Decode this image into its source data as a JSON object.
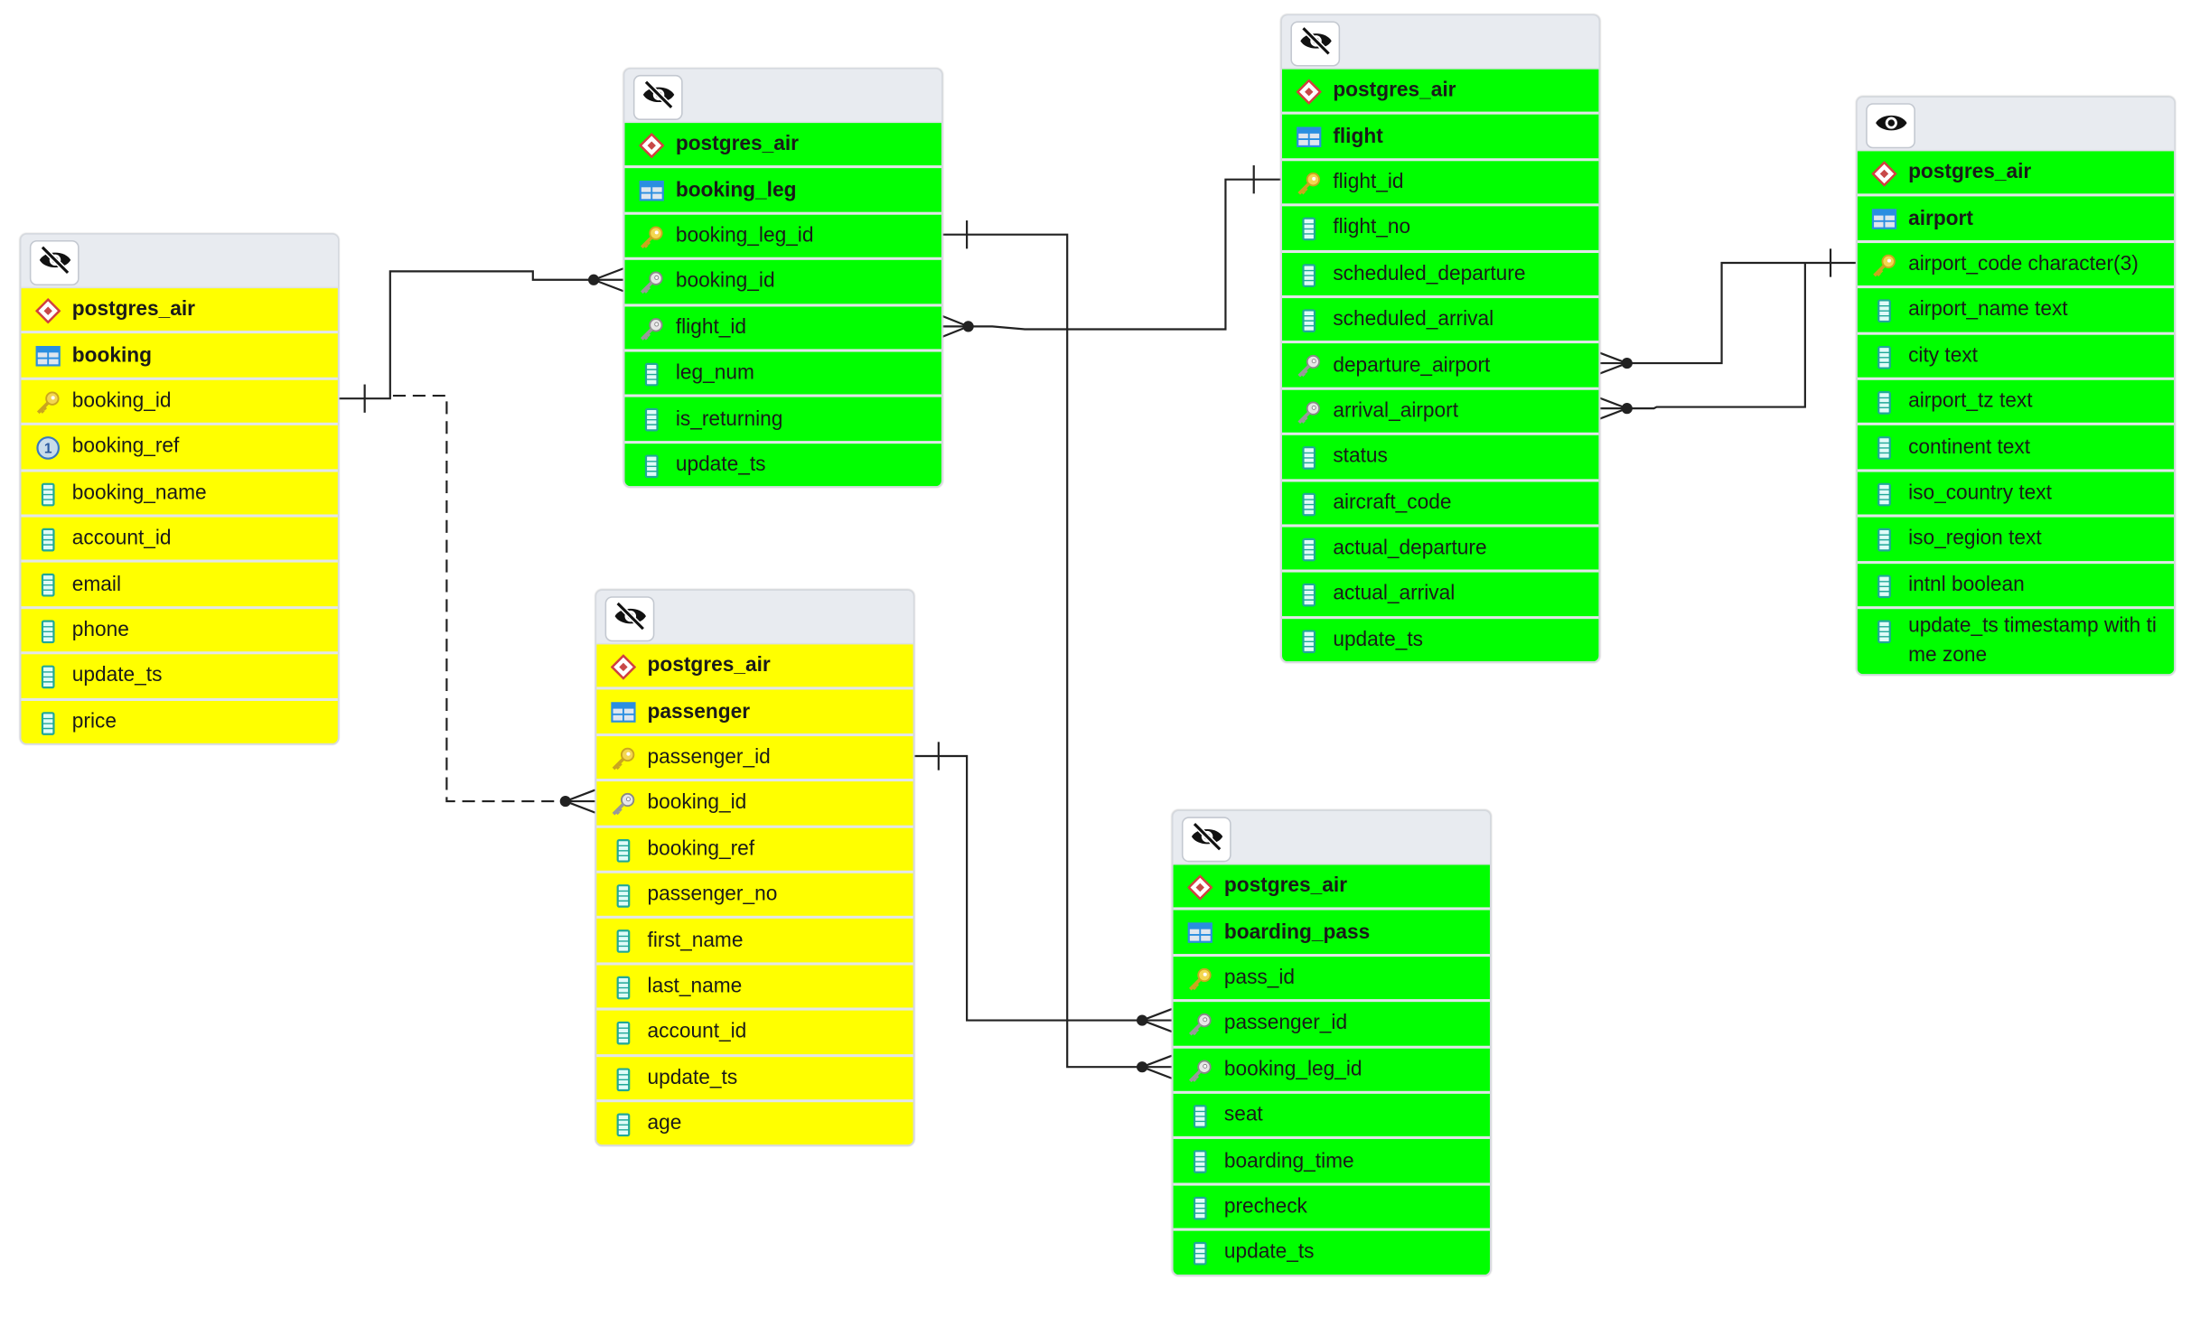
{
  "colors": {
    "yellow_table": "#ffff00",
    "green_table": "#00ff00",
    "header": "#e8ebf0",
    "line": "#222222"
  },
  "tables": [
    {
      "id": "booking",
      "color": "yellow",
      "visibility_icon": "eye-slash-icon",
      "schema": "postgres_air",
      "name": "booking",
      "columns": [
        {
          "label": "booking_id",
          "icon": "pk"
        },
        {
          "label": "booking_ref",
          "icon": "unique"
        },
        {
          "label": "booking_name",
          "icon": "column"
        },
        {
          "label": "account_id",
          "icon": "column"
        },
        {
          "label": "email",
          "icon": "column"
        },
        {
          "label": "phone",
          "icon": "column"
        },
        {
          "label": "update_ts",
          "icon": "column"
        },
        {
          "label": "price",
          "icon": "column"
        }
      ]
    },
    {
      "id": "booking_leg",
      "color": "green",
      "visibility_icon": "eye-slash-icon",
      "schema": "postgres_air",
      "name": "booking_leg",
      "columns": [
        {
          "label": "booking_leg_id",
          "icon": "pk"
        },
        {
          "label": "booking_id",
          "icon": "fk"
        },
        {
          "label": "flight_id",
          "icon": "fk"
        },
        {
          "label": "leg_num",
          "icon": "column"
        },
        {
          "label": "is_returning",
          "icon": "column"
        },
        {
          "label": "update_ts",
          "icon": "column"
        }
      ]
    },
    {
      "id": "flight",
      "color": "green",
      "visibility_icon": "eye-slash-icon",
      "schema": "postgres_air",
      "name": "flight",
      "columns": [
        {
          "label": "flight_id",
          "icon": "pk"
        },
        {
          "label": "flight_no",
          "icon": "column"
        },
        {
          "label": "scheduled_departure",
          "icon": "column"
        },
        {
          "label": "scheduled_arrival",
          "icon": "column"
        },
        {
          "label": "departure_airport",
          "icon": "fk"
        },
        {
          "label": "arrival_airport",
          "icon": "fk"
        },
        {
          "label": "status",
          "icon": "column"
        },
        {
          "label": "aircraft_code",
          "icon": "column"
        },
        {
          "label": "actual_departure",
          "icon": "column"
        },
        {
          "label": "actual_arrival",
          "icon": "column"
        },
        {
          "label": "update_ts",
          "icon": "column"
        }
      ]
    },
    {
      "id": "airport",
      "color": "green",
      "visibility_icon": "eye-icon",
      "schema": "postgres_air",
      "name": "airport",
      "columns": [
        {
          "label": "airport_code character(3)",
          "icon": "pk"
        },
        {
          "label": "airport_name text",
          "icon": "column"
        },
        {
          "label": "city text",
          "icon": "column"
        },
        {
          "label": "airport_tz text",
          "icon": "column"
        },
        {
          "label": "continent text",
          "icon": "column"
        },
        {
          "label": "iso_country text",
          "icon": "column"
        },
        {
          "label": "iso_region text",
          "icon": "column"
        },
        {
          "label": "intnl boolean",
          "icon": "column"
        },
        {
          "label": "update_ts timestamp with time zone",
          "icon": "column"
        }
      ]
    },
    {
      "id": "passenger",
      "color": "yellow",
      "visibility_icon": "eye-slash-icon",
      "schema": "postgres_air",
      "name": "passenger",
      "columns": [
        {
          "label": "passenger_id",
          "icon": "pk"
        },
        {
          "label": "booking_id",
          "icon": "fk"
        },
        {
          "label": "booking_ref",
          "icon": "column"
        },
        {
          "label": "passenger_no",
          "icon": "column"
        },
        {
          "label": "first_name",
          "icon": "column"
        },
        {
          "label": "last_name",
          "icon": "column"
        },
        {
          "label": "account_id",
          "icon": "column"
        },
        {
          "label": "update_ts",
          "icon": "column"
        },
        {
          "label": "age",
          "icon": "column"
        }
      ]
    },
    {
      "id": "boarding_pass",
      "color": "green",
      "visibility_icon": "eye-slash-icon",
      "schema": "postgres_air",
      "name": "boarding_pass",
      "columns": [
        {
          "label": "pass_id",
          "icon": "pk"
        },
        {
          "label": "passenger_id",
          "icon": "fk"
        },
        {
          "label": "booking_leg_id",
          "icon": "fk"
        },
        {
          "label": "seat",
          "icon": "column"
        },
        {
          "label": "boarding_time",
          "icon": "column"
        },
        {
          "label": "precheck",
          "icon": "column"
        },
        {
          "label": "update_ts",
          "icon": "column"
        }
      ]
    }
  ],
  "relationships": [
    {
      "from": "booking.booking_id",
      "to": "booking_leg.booking_id",
      "style": "solid"
    },
    {
      "from": "booking.booking_id",
      "to": "passenger.booking_id",
      "style": "dashed"
    },
    {
      "from": "flight.flight_id",
      "to": "booking_leg.flight_id",
      "style": "solid"
    },
    {
      "from": "booking_leg.booking_leg_id",
      "to": "boarding_pass.booking_leg_id",
      "style": "solid"
    },
    {
      "from": "passenger.passenger_id",
      "to": "boarding_pass.passenger_id",
      "style": "solid"
    },
    {
      "from": "airport.airport_code",
      "to": "flight.departure_airport",
      "style": "solid"
    },
    {
      "from": "airport.airport_code",
      "to": "flight.arrival_airport",
      "style": "solid"
    }
  ]
}
